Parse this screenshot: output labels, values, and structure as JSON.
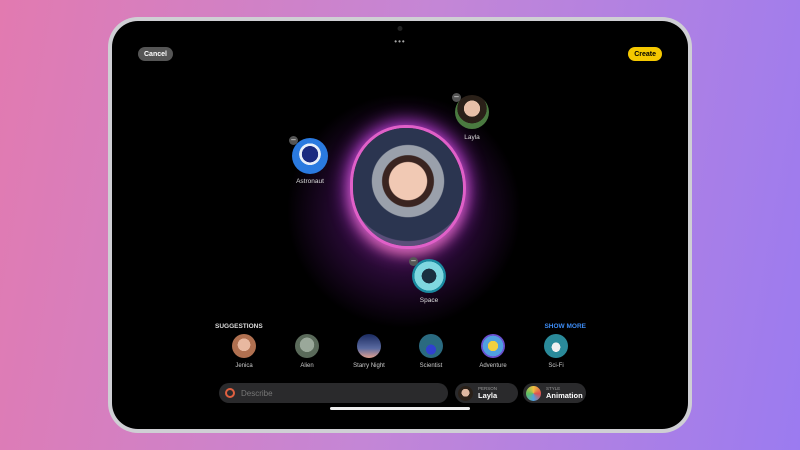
{
  "header": {
    "cancel": "Cancel",
    "create": "Create",
    "more": "•••"
  },
  "canvas": {
    "nodes": [
      {
        "label": "Layla"
      },
      {
        "label": "Astronaut"
      },
      {
        "label": "Space"
      }
    ],
    "remove_symbol": "–"
  },
  "suggestions": {
    "title": "SUGGESTIONS",
    "show_more": "SHOW MORE",
    "items": [
      {
        "label": "Jenica"
      },
      {
        "label": "Alien"
      },
      {
        "label": "Starry Night"
      },
      {
        "label": "Scientist"
      },
      {
        "label": "Adventure"
      },
      {
        "label": "Sci-Fi"
      }
    ]
  },
  "bottom": {
    "describe_placeholder": "Describe",
    "person": {
      "caption": "PERSON",
      "value": "Layla"
    },
    "style": {
      "caption": "STYLE",
      "value": "Animation"
    }
  },
  "colors": {
    "create": "#f5c800",
    "show_more": "#3d8cf5",
    "glow": "#c040e0"
  }
}
